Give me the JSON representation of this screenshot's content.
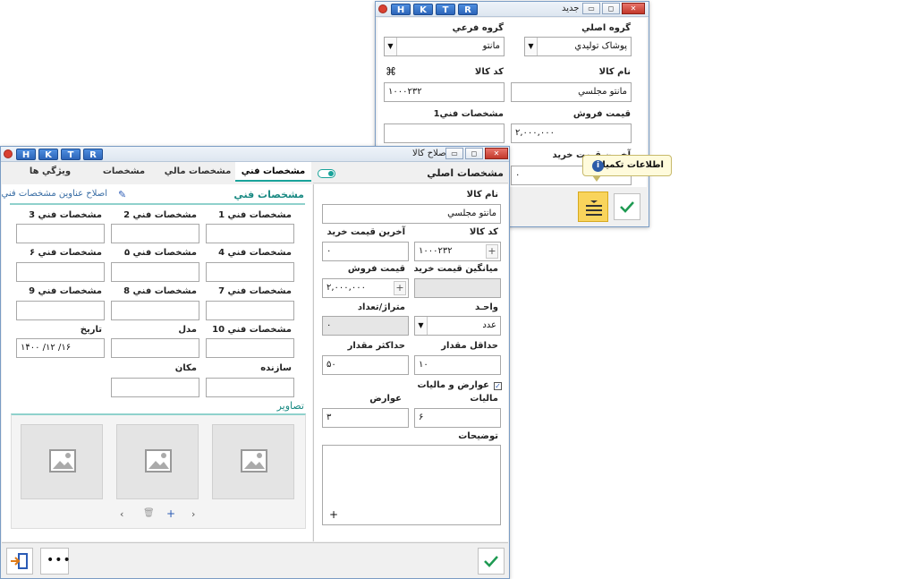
{
  "back_window": {
    "title": "جديد",
    "htkr": [
      "H",
      "K",
      "T",
      "R"
    ],
    "labels": {
      "main_group": "گروه اصلي",
      "sub_group": "گروه فرعي",
      "item_name": "نام کالا",
      "item_code": "کد کالا",
      "sale_price": "قيمت فروش",
      "tech_spec1": "مشخصات فني1",
      "last_purchase": "آخرين قيمت خريد"
    },
    "values": {
      "main_group": "پوشاک توليدي",
      "sub_group": "مانتو",
      "item_name": "مانتو مجلسي",
      "item_code": "۱۰۰۰۲۳۲",
      "sale_price": "۲,۰۰۰,۰۰۰",
      "last_purchase": "۰"
    },
    "tooltip": "اطلاعات تکميلي"
  },
  "front_window": {
    "title": "اصلاح کالا",
    "htkr": [
      "H",
      "K",
      "T",
      "R"
    ],
    "tabs": [
      "مشخصات فني",
      "مشخصات مالي",
      "مشخصات تنظيمي",
      "ويژگي ها"
    ],
    "right_header": "مشخصات اصلي",
    "left": {
      "section": "مشخصات فني",
      "edit_link": "اصلاح عناوين مشخصات فني",
      "spec_labels": [
        "مشخصات فني 1",
        "مشخصات فني 2",
        "مشخصات فني 3",
        "مشخصات فني 4",
        "مشخصات فني ۵",
        "مشخصات فني ۶",
        "مشخصات فني 7",
        "مشخصات فني 8",
        "مشخصات فني 9",
        "مشخصات فني 10",
        "مدل",
        "تاريخ",
        "سازنده",
        "مکان"
      ],
      "date_value": "۱۴۰۰ /۱۲ /۱۶",
      "images_title": "تصاوير"
    },
    "right": {
      "labels": {
        "item_name": "نام کالا",
        "item_code": "کد کالا",
        "last_purchase": "آخرين قيمت خريد",
        "avg_purchase": "ميانگين قيمت خريد",
        "sale_price": "قيمت فروش",
        "unit": "واحـد",
        "meter_count": "متراژ/تعداد",
        "min_qty": "حداقل مقدار",
        "max_qty": "حداکثر مقدار",
        "tax_toggle": "عوارض و ماليات",
        "tax": "ماليات",
        "duties": "عوارض",
        "description": "توضيحات"
      },
      "values": {
        "item_name": "مانتو مجلسي",
        "item_code": "۱۰۰۰۲۳۲",
        "last_purchase": "۰",
        "avg_purchase": "",
        "sale_price": "۲,۰۰۰,۰۰۰",
        "unit": "عدد",
        "meter_count": "۰",
        "min_qty": "۱۰",
        "max_qty": "۵۰",
        "tax": "۶",
        "duties": "۳"
      }
    }
  }
}
